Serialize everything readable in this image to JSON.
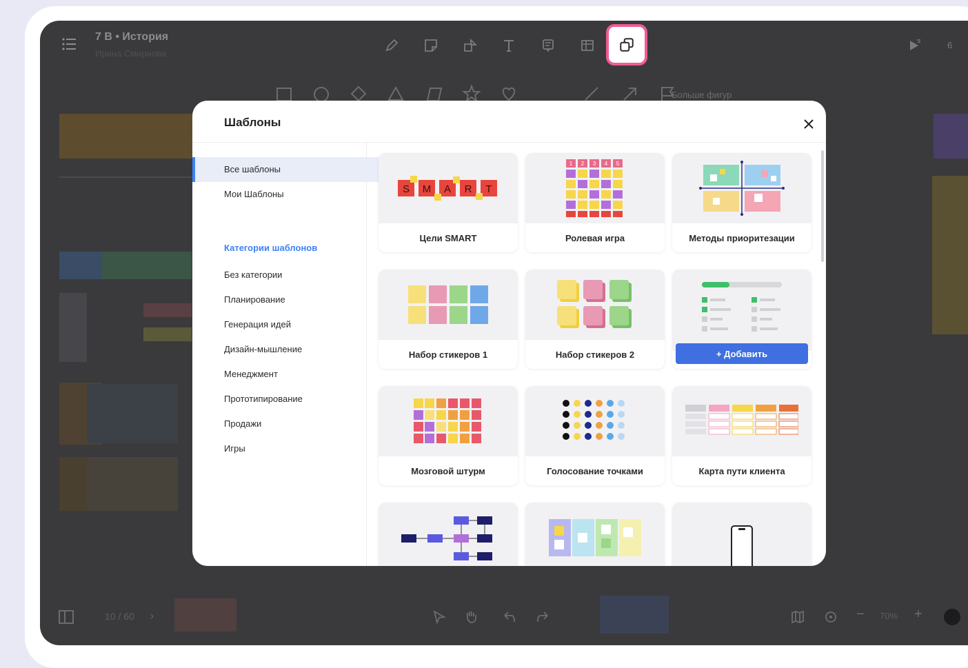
{
  "app": {
    "title": "7 В • История",
    "subtitle": "Ирина Смирнова",
    "pager": "10 / 60",
    "zoom": "70%",
    "more_shapes": "Больше фигур",
    "user_count": "6"
  },
  "toolbar": {
    "tools": [
      {
        "name": "pencil-icon"
      },
      {
        "name": "sticker-icon"
      },
      {
        "name": "shapes-icon"
      },
      {
        "name": "text-icon"
      },
      {
        "name": "comment-icon"
      },
      {
        "name": "table-icon"
      },
      {
        "name": "templates-icon"
      }
    ],
    "accent": "#ef5b95"
  },
  "modal": {
    "title": "Шаблоны",
    "close_label": "×",
    "sidebar": {
      "all": "Все шаблоны",
      "mine": "Мои Шаблоны",
      "categories_title": "Категории шаблонов",
      "categories": [
        "Без категории",
        "Планирование",
        "Генерация идей",
        "Дизайн-мышление",
        "Менеджмент",
        "Прототипирование",
        "Продажи",
        "Игры"
      ]
    },
    "templates": [
      {
        "label": "Цели SMART"
      },
      {
        "label": "Ролевая игра"
      },
      {
        "label": "Методы приоритезации"
      },
      {
        "label": "Набор стикеров 1"
      },
      {
        "label": "Набор стикеров 2"
      },
      {
        "label": ""
      },
      {
        "label": "Мозговой штурм"
      },
      {
        "label": "Голосование точками"
      },
      {
        "label": "Карта пути клиента"
      }
    ],
    "add_button": "+ Добавить",
    "smart_letters": [
      "S",
      "M",
      "A",
      "R",
      "T"
    ],
    "role_numbers": [
      "1",
      "2",
      "3",
      "4",
      "5"
    ]
  },
  "colors": {
    "accent_blue": "#3b82f6",
    "add_button": "#3f6fe0",
    "smart_red": "#e8453c",
    "sticky_yellow": "#f7d64a"
  }
}
